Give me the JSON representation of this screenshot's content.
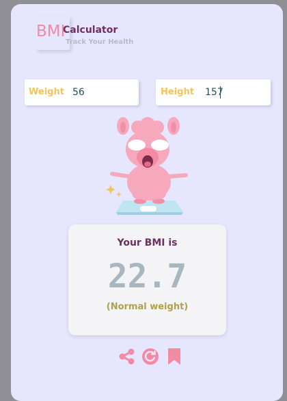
{
  "app": {
    "logo_text": "BMI",
    "title": "Calculator",
    "subtitle": "Track Your Health"
  },
  "inputs": {
    "weight": {
      "label": "Weight",
      "value": "56"
    },
    "height": {
      "label": "Height",
      "value": "157"
    }
  },
  "result": {
    "title": "Your BMI is",
    "value": "22.7",
    "category": "(Normal weight)"
  },
  "actions": {
    "share_icon": "share-icon",
    "reset_icon": "refresh-icon",
    "save_icon": "bookmark-icon"
  },
  "colors": {
    "accent": "#f28aa2",
    "title": "#6e2f61",
    "label": "#f3c45a",
    "background": "#e6e6ff"
  }
}
